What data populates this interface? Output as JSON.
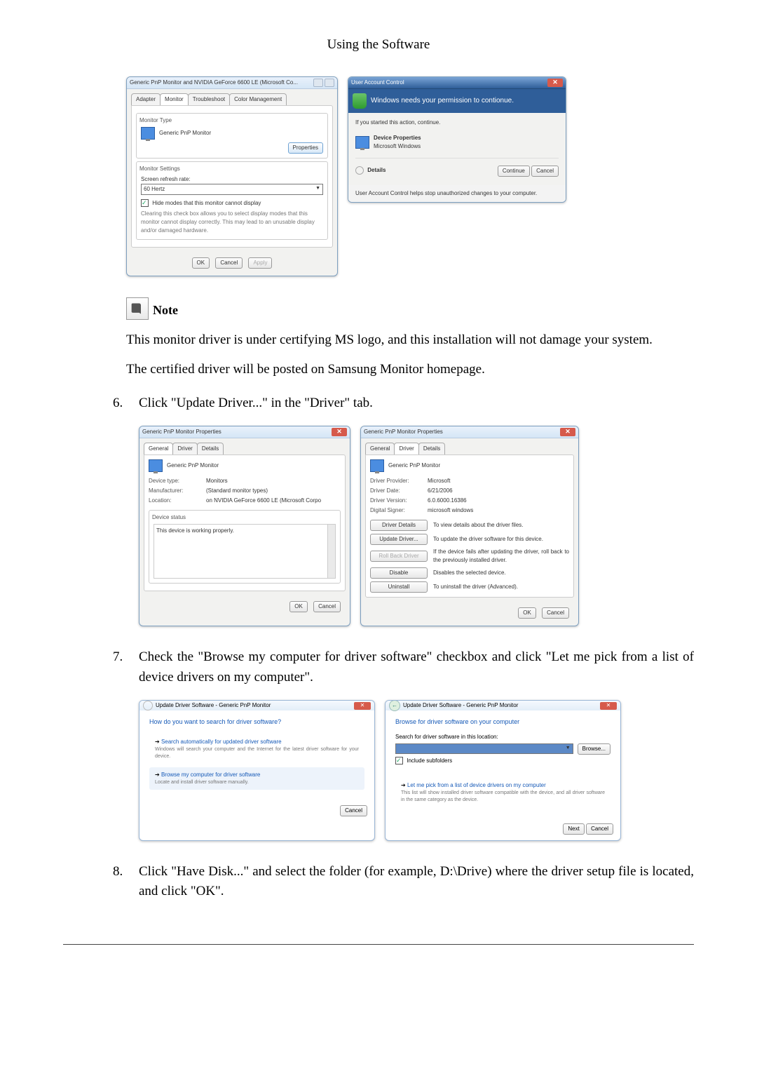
{
  "header": "Using the Software",
  "monitor_dialog": {
    "title": "Generic PnP Monitor and NVIDIA GeForce 6600 LE (Microsoft Co...",
    "tabs": {
      "adapter": "Adapter",
      "monitor": "Monitor",
      "troubleshoot": "Troubleshoot",
      "color": "Color Management"
    },
    "mon_type_label": "Monitor Type",
    "mon_type_value": "Generic PnP Monitor",
    "properties_btn": "Properties",
    "mon_settings_label": "Monitor Settings",
    "refresh_label": "Screen refresh rate:",
    "refresh_value": "60 Hertz",
    "hide_modes_label": "Hide modes that this monitor cannot display",
    "clear_note": "Clearing this check box allows you to select display modes that this monitor cannot display correctly. This may lead to an unusable display and/or damaged hardware.",
    "ok": "OK",
    "cancel": "Cancel",
    "apply": "Apply"
  },
  "uac": {
    "titlebar": "User Account Control",
    "banner": "Windows needs your permission to contionue.",
    "started": "If you started this action, continue.",
    "dev_props": "Device Properties",
    "ms_windows": "Microsoft Windows",
    "details": "Details",
    "continue": "Continue",
    "cancel": "Cancel",
    "footer": "User Account Control helps stop unauthorized changes to your computer."
  },
  "note_label": "Note",
  "note_para1": "This monitor driver is under certifying MS logo, and this installation will not damage your system.",
  "note_para2": "The certified driver will be posted on Samsung Monitor homepage.",
  "step6": "Click \"Update Driver...\" in the \"Driver\" tab.",
  "props_general": {
    "title": "Generic PnP Monitor Properties",
    "tabs": {
      "general": "General",
      "driver": "Driver",
      "details": "Details"
    },
    "name": "Generic PnP Monitor",
    "dev_type_k": "Device type:",
    "dev_type_v": "Monitors",
    "manu_k": "Manufacturer:",
    "manu_v": "(Standard monitor types)",
    "loc_k": "Location:",
    "loc_v": "on NVIDIA GeForce 6600 LE (Microsoft Corpo",
    "status_label": "Device status",
    "status_text": "This device is working properly.",
    "ok": "OK",
    "cancel": "Cancel"
  },
  "props_driver": {
    "title": "Generic PnP Monitor Properties",
    "tabs": {
      "general": "General",
      "driver": "Driver",
      "details": "Details"
    },
    "name": "Generic PnP Monitor",
    "prov_k": "Driver Provider:",
    "prov_v": "Microsoft",
    "date_k": "Driver Date:",
    "date_v": "6/21/2006",
    "ver_k": "Driver Version:",
    "ver_v": "6.0.6000.16386",
    "sign_k": "Digital Signer:",
    "sign_v": "microsoft windows",
    "btn_details": "Driver Details",
    "btn_details_desc": "To view details about the driver files.",
    "btn_update": "Update Driver...",
    "btn_update_desc": "To update the driver software for this device.",
    "btn_rollback": "Roll Back Driver",
    "btn_rollback_desc": "If the device fails after updating the driver, roll back to the previously installed driver.",
    "btn_disable": "Disable",
    "btn_disable_desc": "Disables the selected device.",
    "btn_uninstall": "Uninstall",
    "btn_uninstall_desc": "To uninstall the driver (Advanced).",
    "ok": "OK",
    "cancel": "Cancel"
  },
  "step7": "Check the \"Browse my computer for driver software\" checkbox and click \"Let me pick from a list of device drivers on my computer\".",
  "wizard_a": {
    "breadcrumb": "Update Driver Software - Generic PnP Monitor",
    "heading": "How do you want to search for driver software?",
    "opt1_title": "Search automatically for updated driver software",
    "opt1_desc": "Windows will search your computer and the Internet for the latest driver software for your device.",
    "opt2_title": "Browse my computer for driver software",
    "opt2_desc": "Locate and install driver software manually.",
    "cancel": "Cancel"
  },
  "wizard_b": {
    "breadcrumb": "Update Driver Software - Generic PnP Monitor",
    "heading": "Browse for driver software on your computer",
    "search_label": "Search for driver software in this location:",
    "browse": "Browse...",
    "include": "Include subfolders",
    "pick_title": "Let me pick from a list of device drivers on my computer",
    "pick_desc": "This list will show installed driver software compatible with the device, and all driver software in the same category as the device.",
    "next": "Next",
    "cancel": "Cancel"
  },
  "step8": "Click \"Have Disk...\" and select the folder (for example, D:\\Drive) where the driver setup file is located, and click \"OK\"."
}
